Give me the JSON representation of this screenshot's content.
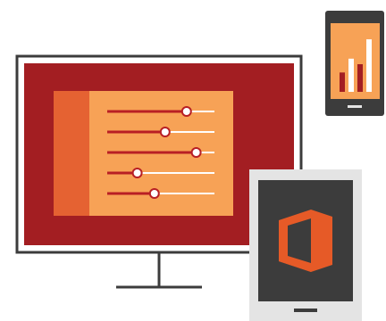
{
  "colors": {
    "background": "#ffffff",
    "bezel_dark": "#3c3c3c",
    "bezel_light": "#e4e4e4",
    "screen_red": "#a31e22",
    "panel_orange": "#f7a256",
    "panel_accent": "#e56232",
    "slider_track": "#b81f24",
    "slider_rest": "#ffffff",
    "office_orange": "#e65a27"
  },
  "monitor": {
    "icon": "desktop-monitor-icon",
    "sliders": [
      {
        "name": "slider-1",
        "value": 0.74
      },
      {
        "name": "slider-2",
        "value": 0.54
      },
      {
        "name": "slider-3",
        "value": 0.83
      },
      {
        "name": "slider-4",
        "value": 0.28
      },
      {
        "name": "slider-5",
        "value": 0.44
      }
    ]
  },
  "phone": {
    "icon": "phone-icon",
    "bars": [
      0.35,
      0.6,
      0.5,
      0.95
    ],
    "bar_colors": [
      "#a31e22",
      "#ffffff",
      "#a31e22",
      "#ffffff"
    ]
  },
  "tablet": {
    "icon": "tablet-icon",
    "logo": "office-logo-icon"
  }
}
